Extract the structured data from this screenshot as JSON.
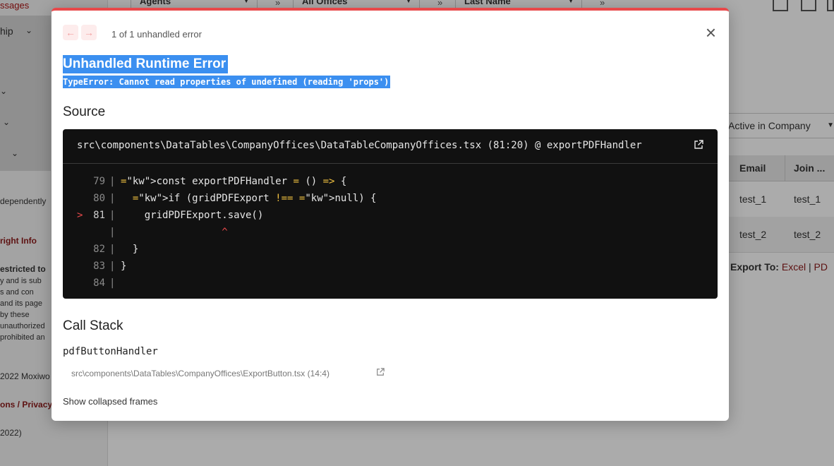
{
  "background": {
    "sidebar": {
      "top_text": "ssages",
      "menu_label": "hip",
      "independently": "dependently",
      "copyright": "right Info",
      "restricted": "estricted to",
      "para_lines": [
        "y  and  is  sub",
        "s    and    con",
        " and its page",
        " by    these",
        "unauthorized",
        "prohibited an"
      ],
      "year_text": "2022 Moxiwo",
      "terms": "ons / Privacy",
      "version": "2022)"
    },
    "toolbar": {
      "dropdowns": [
        "Agents",
        "All Offices",
        "Last Name"
      ],
      "double_arrow": "»"
    },
    "filter_value": "Active in Company",
    "grid": {
      "columns": [
        "Email",
        "Join ..."
      ],
      "rows": [
        [
          "test_1",
          "test_1"
        ],
        [
          "test_2",
          "test_2"
        ]
      ]
    },
    "export": {
      "label": "Export To:",
      "excel": "Excel",
      "sep": "|",
      "pdf": "PD"
    }
  },
  "error_overlay": {
    "nav": {
      "prev": "←",
      "next": "→"
    },
    "count_text": "1 of 1 unhandled error",
    "close": "×",
    "title": "Unhandled Runtime Error",
    "message": "TypeError: Cannot read properties of undefined (reading 'props')",
    "source_heading": "Source",
    "source_path": "src\\components\\DataTables\\CompanyOffices\\DataTableCompanyOffices.tsx (81:20) @ exportPDFHandler",
    "code_lines": [
      {
        "num": "79",
        "mark": "",
        "text": "const exportPDFHandler = () => {"
      },
      {
        "num": "80",
        "mark": "",
        "text": "  if (gridPDFExport !== null) {"
      },
      {
        "num": "81",
        "mark": ">",
        "text": "    gridPDFExport.save()"
      },
      {
        "num": "",
        "mark": "",
        "text": "                 ^"
      },
      {
        "num": "82",
        "mark": "",
        "text": "  }"
      },
      {
        "num": "83",
        "mark": "",
        "text": "}"
      },
      {
        "num": "84",
        "mark": "",
        "text": ""
      }
    ],
    "call_stack_heading": "Call Stack",
    "stack_function": "pdfButtonHandler",
    "stack_location": "src\\components\\DataTables\\CompanyOffices\\ExportButton.tsx (14:4)",
    "show_collapsed": "Show collapsed frames"
  }
}
